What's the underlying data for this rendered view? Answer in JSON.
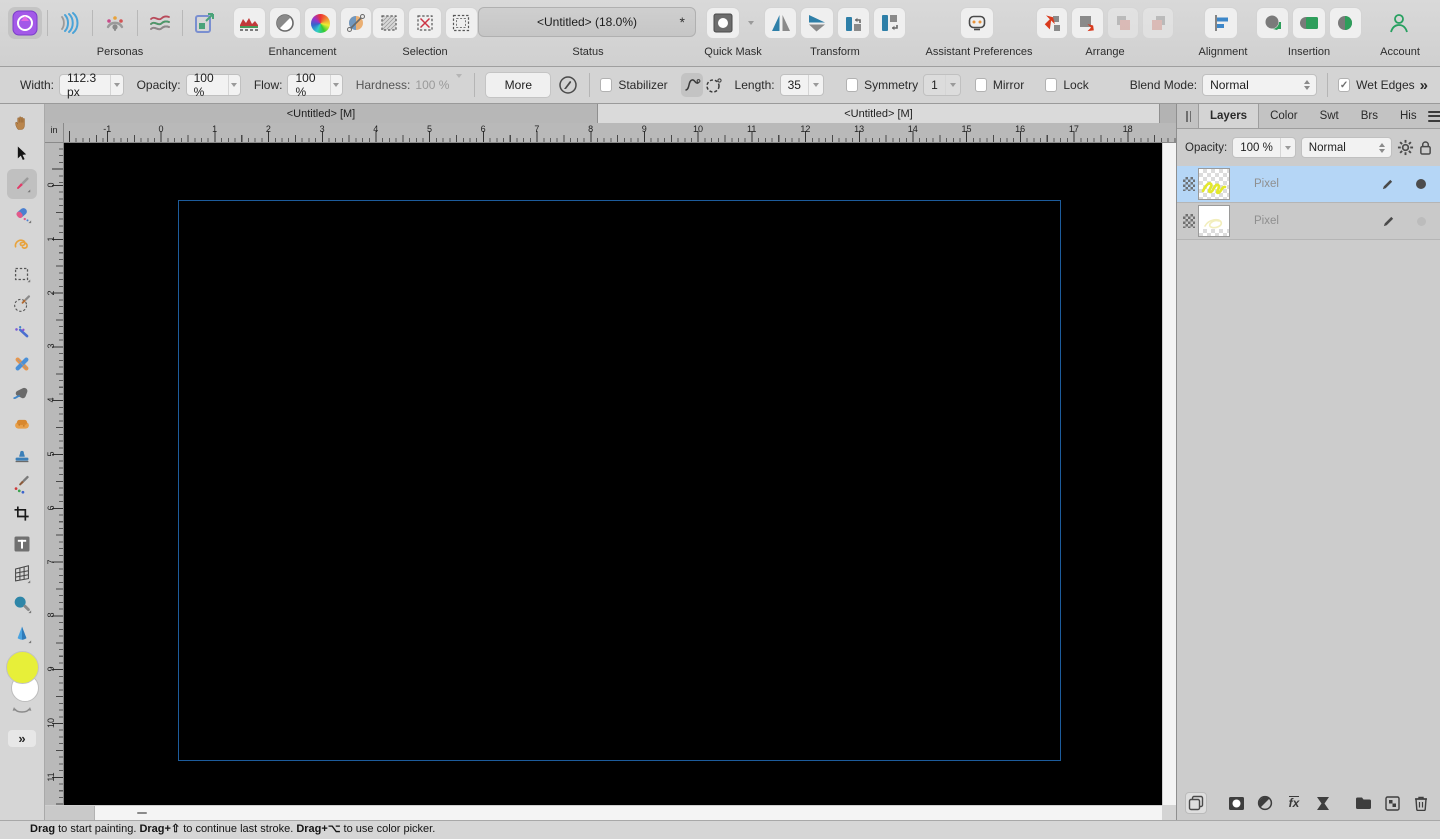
{
  "top_toolbar": {
    "personas": {
      "label": "Personas"
    },
    "enhancement": {
      "label": "Enhancement"
    },
    "selection": {
      "label": "Selection"
    },
    "status": {
      "label": "Status",
      "document_title": "<Untitled> (18.0%)",
      "modified_indicator": "*"
    },
    "quick_mask": {
      "label": "Quick Mask"
    },
    "transform": {
      "label": "Transform"
    },
    "assistant": {
      "label": "Assistant Preferences"
    },
    "arrange": {
      "label": "Arrange"
    },
    "alignment": {
      "label": "Alignment"
    },
    "insertion": {
      "label": "Insertion"
    },
    "account": {
      "label": "Account"
    }
  },
  "context_toolbar": {
    "width": {
      "label": "Width:",
      "value": "112.3 px"
    },
    "opacity": {
      "label": "Opacity:",
      "value": "100 %"
    },
    "flow": {
      "label": "Flow:",
      "value": "100 %"
    },
    "hardness": {
      "label": "Hardness:",
      "value": "100 %"
    },
    "more_label": "More",
    "stabilizer_label": "Stabilizer",
    "length": {
      "label": "Length:",
      "value": "35"
    },
    "symmetry": {
      "label": "Symmetry",
      "value": "1"
    },
    "mirror_label": "Mirror",
    "lock_label": "Lock",
    "blend_mode": {
      "label": "Blend Mode:",
      "value": "Normal"
    },
    "wet_edges_label": "Wet Edges",
    "check_glyph": "✓",
    "overflow_glyph": "»"
  },
  "document_tabs": [
    {
      "title": "<Untitled> [M]"
    },
    {
      "title": "<Untitled> [M]"
    }
  ],
  "rulers": {
    "unit": "in",
    "horizontal_labels": [
      "-1",
      "0",
      "1",
      "2",
      "3",
      "4",
      "5",
      "6",
      "7",
      "8",
      "9",
      "10",
      "11",
      "12",
      "13",
      "14",
      "15",
      "16",
      "17",
      "18"
    ],
    "vertical_labels": [
      "0",
      "1",
      "2",
      "3",
      "4",
      "5",
      "6",
      "7",
      "8",
      "9",
      "10",
      "11"
    ]
  },
  "tools_panel": {
    "more_glyph": "»"
  },
  "layers_panel": {
    "tabs": {
      "layers": "Layers",
      "color": "Color",
      "swatches": "Swt",
      "brushes": "Brs",
      "history": "His"
    },
    "opacity": {
      "label": "Opacity:",
      "value": "100 %"
    },
    "blend_mode": "Normal",
    "layers": [
      {
        "name": "Pixel",
        "selected": true,
        "visible": true
      },
      {
        "name": "Pixel",
        "selected": false,
        "visible": false
      }
    ]
  },
  "status_bar": {
    "segments": [
      {
        "text": "Drag",
        "bold": true
      },
      {
        "text": " to start painting. ",
        "bold": false
      },
      {
        "text": "Drag+⇧",
        "bold": true
      },
      {
        "text": " to continue last stroke. ",
        "bold": false
      },
      {
        "text": "Drag+⌥",
        "bold": true
      },
      {
        "text": " to use color picker.",
        "bold": false
      }
    ]
  },
  "colors": {
    "selected_layer_row": "#b5d6f6",
    "page_outline": "#1d5c9c",
    "canvas_background": "#000000",
    "foreground_swatch": "#e7ef39",
    "background_swatch": "#ffffff",
    "persona_accent": "#a359e8",
    "transform_blue": "#2e7fa8",
    "arrange_red": "#d93a1d",
    "insertion_green": "#2e9e5b"
  }
}
